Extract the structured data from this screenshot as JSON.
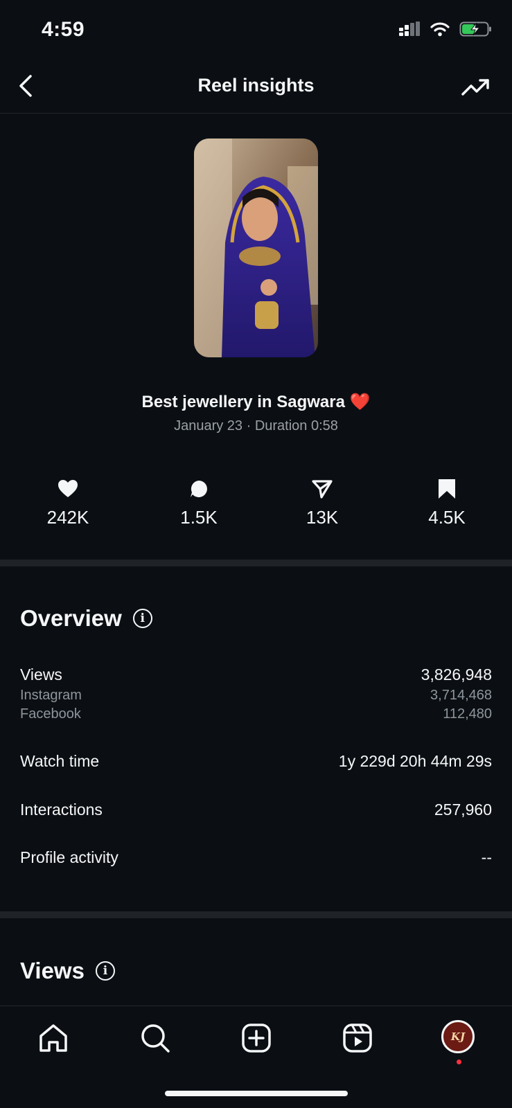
{
  "status_bar": {
    "time": "4:59"
  },
  "header": {
    "title": "Reel insights"
  },
  "reel": {
    "title": "Best jewellery in Sagwara ❤️",
    "subtitle": "January 23 · Duration 0:58"
  },
  "metrics": [
    {
      "icon": "heart-icon",
      "value": "242K"
    },
    {
      "icon": "comment-icon",
      "value": "1.5K"
    },
    {
      "icon": "share-icon",
      "value": "13K"
    },
    {
      "icon": "bookmark-icon",
      "value": "4.5K"
    }
  ],
  "overview": {
    "title": "Overview",
    "views_label": "Views",
    "views_value": "3,826,948",
    "instagram_label": "Instagram",
    "instagram_value": "3,714,468",
    "facebook_label": "Facebook",
    "facebook_value": "112,480",
    "watch_time_label": "Watch time",
    "watch_time_value": "1y 229d 20h 44m 29s",
    "interactions_label": "Interactions",
    "interactions_value": "257,960",
    "profile_activity_label": "Profile activity",
    "profile_activity_value": "--"
  },
  "views_section": {
    "title": "Views"
  },
  "bottom_nav": {
    "items": [
      "home-icon",
      "search-icon",
      "create-icon",
      "reels-icon",
      "profile-avatar"
    ],
    "avatar_text": "KJ"
  },
  "colors": {
    "background": "#0b0f14",
    "divider": "#1f2328",
    "muted": "#9aa0a6",
    "notification": "#ff3040"
  }
}
